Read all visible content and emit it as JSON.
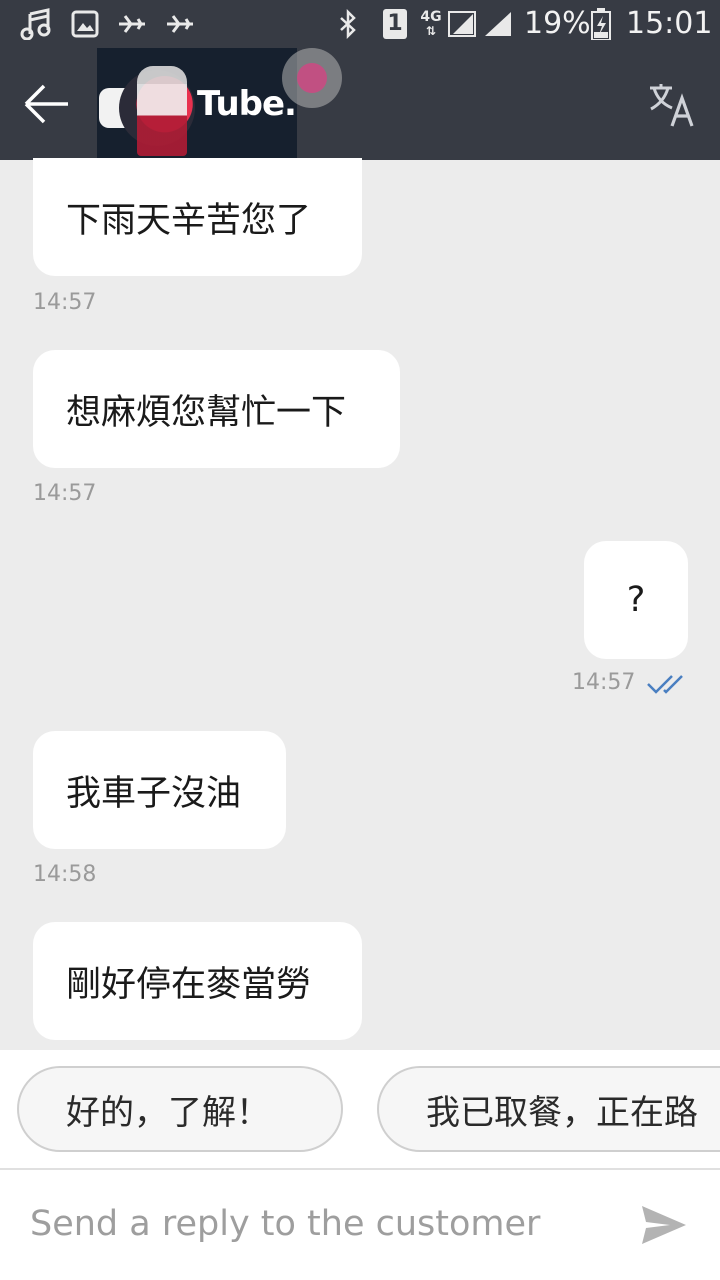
{
  "status_bar": {
    "sim_label": "1",
    "network_label": "4G",
    "battery_percent": "19%",
    "time": "15:01",
    "icons": [
      "music-icon",
      "image-icon",
      "flight-icon",
      "flight-icon",
      "bluetooth-icon",
      "sim-icon",
      "signal-icon",
      "battery-icon"
    ]
  },
  "app_bar": {
    "thumbnail_text": "Tube.",
    "icons": [
      "back-arrow-icon",
      "translate-icon"
    ]
  },
  "messages": [
    {
      "side": "left",
      "text": "下雨天辛苦您了",
      "time": "14:57"
    },
    {
      "side": "left",
      "text": "想麻煩您幫忙一下",
      "time": "14:57"
    },
    {
      "side": "right",
      "text": "?",
      "time": "14:57",
      "status_icon": "double-check-icon"
    },
    {
      "side": "left",
      "text": "我車子沒油",
      "time": "14:58"
    },
    {
      "side": "left",
      "text": "剛好停在麥當勞",
      "time": ""
    }
  ],
  "quick_replies": [
    "好的，了解！",
    "我已取餐，正在路"
  ],
  "composer": {
    "placeholder": "Send a reply to the customer",
    "send_icon": "send-icon"
  },
  "colors": {
    "bar": "#373b44",
    "background": "#ececec",
    "bubble": "#ffffff",
    "check": "#4a7fc1"
  }
}
